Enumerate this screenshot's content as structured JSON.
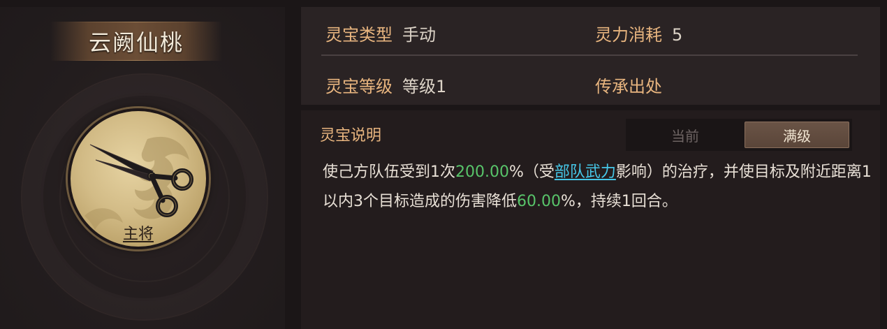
{
  "item": {
    "name": "云阙仙桃",
    "role": "主将"
  },
  "info": {
    "type_label": "灵宝类型",
    "type_value": "手动",
    "cost_label": "灵力消耗",
    "cost_value": "5",
    "level_label": "灵宝等级",
    "level_value": "等级1",
    "source_label": "传承出处"
  },
  "description": {
    "title": "灵宝说明",
    "tabs": [
      "当前",
      "满级"
    ],
    "active_tab": "满级",
    "seg1": "使己方队伍受到1次",
    "value1": "200.00",
    "seg2": "%（受",
    "link": "部队武力",
    "seg3": "影响）的治疗，并使目标及附近距离1以内3个目标造成的伤害降低",
    "value2": "60.00",
    "seg4": "%，持续1回合。"
  },
  "colors": {
    "label_gold": "#e8b57f",
    "highlight_green": "#58c46a",
    "link_cyan": "#46c7e8"
  },
  "icons": [
    "scissors-icon",
    "dragon-emblem-icon"
  ]
}
